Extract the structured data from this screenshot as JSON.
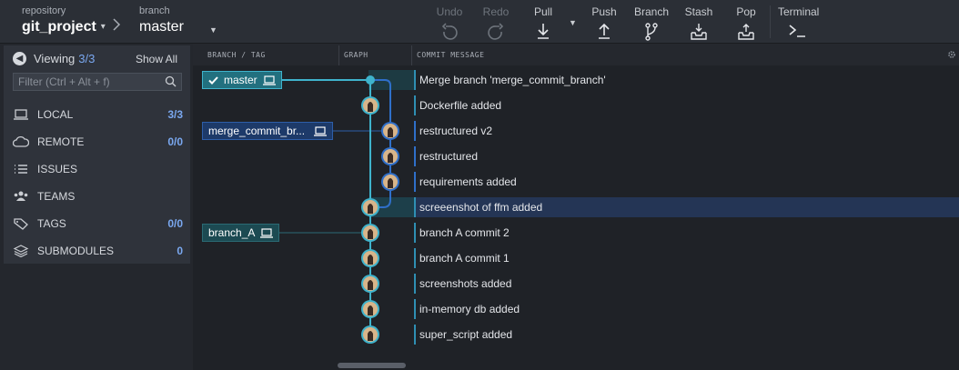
{
  "toolbar": {
    "repository_label": "repository",
    "repository_name": "git_project",
    "branch_label": "branch",
    "branch_name": "master",
    "buttons": [
      {
        "label": "Undo",
        "icon": "undo-icon",
        "enabled": false
      },
      {
        "label": "Redo",
        "icon": "redo-icon",
        "enabled": false
      },
      {
        "label": "Pull",
        "icon": "pull-icon",
        "enabled": true
      },
      {
        "label": "Push",
        "icon": "push-icon",
        "enabled": true
      },
      {
        "label": "Branch",
        "icon": "branch-icon",
        "enabled": true
      },
      {
        "label": "Stash",
        "icon": "stash-icon",
        "enabled": true
      },
      {
        "label": "Pop",
        "icon": "pop-icon",
        "enabled": true
      }
    ],
    "terminal_label": "Terminal"
  },
  "left_panel": {
    "viewing_label": "Viewing",
    "viewing_count": "3/3",
    "show_all": "Show All",
    "filter_placeholder": "Filter (Ctrl + Alt + f)",
    "sections": [
      {
        "label": "LOCAL",
        "count": "3/3",
        "icon": "laptop-icon"
      },
      {
        "label": "REMOTE",
        "count": "0/0",
        "icon": "cloud-icon"
      },
      {
        "label": "ISSUES",
        "count": "",
        "icon": "list-icon"
      },
      {
        "label": "TEAMS",
        "count": "",
        "icon": "people-icon"
      },
      {
        "label": "TAGS",
        "count": "0/0",
        "icon": "tag-icon"
      },
      {
        "label": "SUBMODULES",
        "count": "0",
        "icon": "layers-icon"
      }
    ]
  },
  "columns": {
    "branch_tag": "BRANCH / TAG",
    "graph": "GRAPH",
    "commit_message": "COMMIT MESSAGE"
  },
  "branches": [
    {
      "name": "master",
      "checked_out": true
    },
    {
      "name": "merge_commit_br...",
      "checked_out": false
    },
    {
      "name": "branch_A",
      "checked_out": false
    }
  ],
  "commits": [
    "Merge branch 'merge_commit_branch'",
    "Dockerfile added",
    "restructured v2",
    "restructured",
    "requirements added",
    "screeenshot of ffm added",
    "branch A commit 2",
    "branch A commit 1",
    "screenshots added",
    "in-memory db added",
    "super_script added"
  ],
  "selected_commit_index": 5,
  "colors": {
    "accent_teal": "#3fb3cc",
    "accent_blue": "#2f6fc9",
    "count_blue": "#7aa8f0",
    "selected_row": "#243555"
  }
}
